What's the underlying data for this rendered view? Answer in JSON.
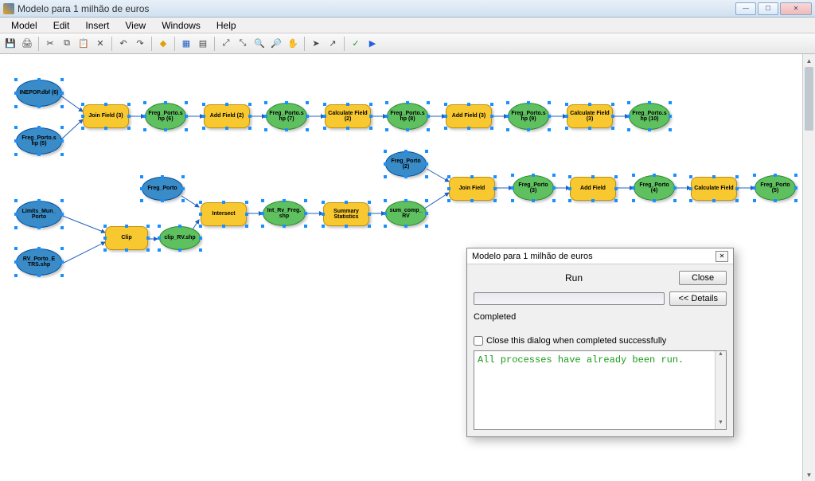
{
  "window": {
    "title": "Modelo para 1 milhão de euros"
  },
  "menu": {
    "model": "Model",
    "edit": "Edit",
    "insert": "Insert",
    "view": "View",
    "windows": "Windows",
    "help": "Help"
  },
  "nodes": {
    "inepop": "INEPOP.dbf (6)",
    "freg_porto_s5": "Freg_Porto.s hp (5)",
    "join_field_3": "Join Field (3)",
    "freg_porto_s6": "Freg_Porto.s hp (6)",
    "add_field_2": "Add Field (2)",
    "freg_porto_s7": "Freg_Porto.s hp (7)",
    "calc_field_2": "Calculate Field (2)",
    "freg_porto_s8": "Freg_Porto.s hp (8)",
    "add_field_3": "Add Field (3)",
    "freg_porto_s9": "Freg_Porto.s hp (9)",
    "calc_field_3": "Calculate Field (3)",
    "freg_porto_s10": "Freg_Porto.s hp (10)",
    "limits_mun": "Limits_Mun_ Porto",
    "rv_porto_etrs": "RV_Porto_E TRS.shp",
    "clip": "Clip",
    "freg_porto": "Freg_Porto",
    "clip_rv": "clip_RV.shp",
    "intersect": "Intersect",
    "int_rv_freg": "Int_Rv_Freg. shp",
    "summary_stats": "Summary Statistics",
    "sum_comp_rv": "sum_comp_ RV",
    "freg_porto_2": "Freg_Porto (2)",
    "join_field": "Join Field",
    "freg_porto_3": "Freg_Porto (3)",
    "add_field": "Add Field",
    "freg_porto_4": "Freg_Porto (4)",
    "calc_field": "Calculate Field",
    "freg_porto_5": "Freg_Porto (5)"
  },
  "dialog": {
    "title": "Modelo para 1 milhão de euros",
    "run": "Run",
    "close": "Close",
    "details": "<< Details",
    "status": "Completed",
    "checkbox": "Close this dialog when completed successfully",
    "message": "All processes have already been run."
  }
}
